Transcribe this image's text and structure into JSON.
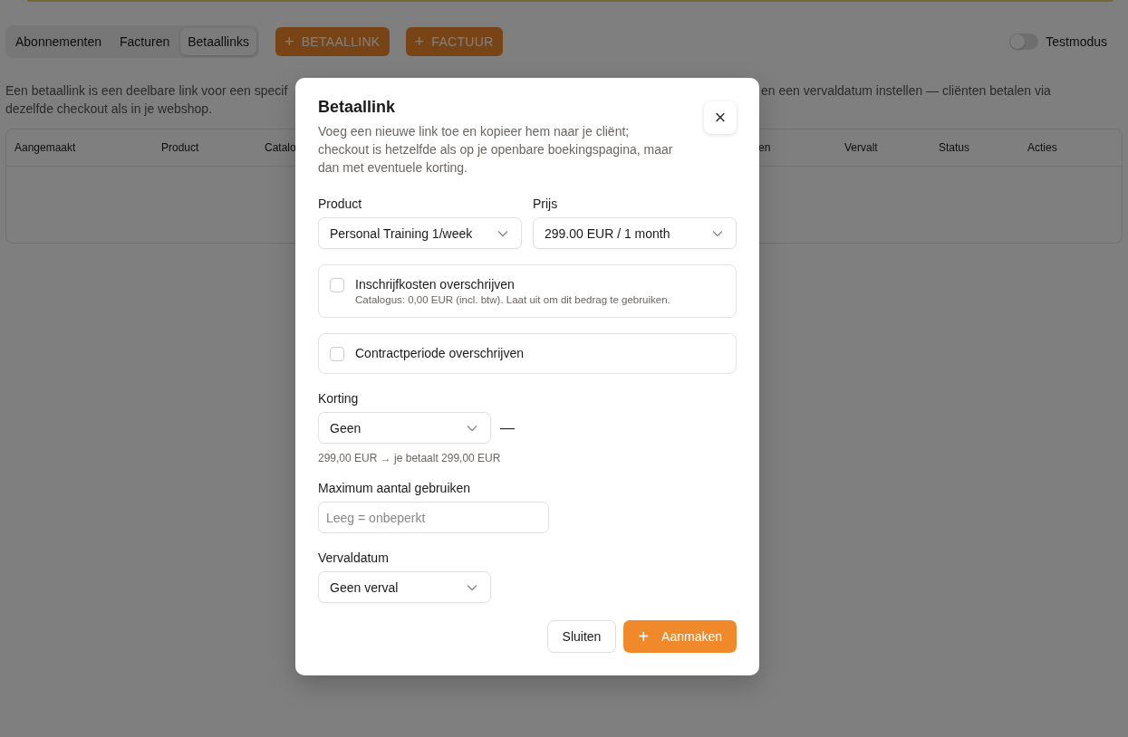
{
  "tabs": [
    {
      "label": "Abonnementen",
      "selected": false
    },
    {
      "label": "Facturen",
      "selected": false
    },
    {
      "label": "Betaallinks",
      "selected": true
    }
  ],
  "actions": [
    {
      "icon": "+",
      "label": "BETAALLINK"
    },
    {
      "icon": "+",
      "label": "FACTUUR"
    }
  ],
  "testmode": {
    "label": "Testmodus",
    "on": false
  },
  "description": {
    "line_1_start": "Een betaallink is een deelbare link voor een specif",
    "line_1_end": "en een vervaldatum instellen — cliënten betalen via",
    "line_2": "dezelfde checkout als in je webshop."
  },
  "table": {
    "columns": [
      "Aangemaakt",
      "Product",
      "Catalo",
      "en",
      "Vervalt",
      "Status",
      "Acties"
    ]
  },
  "dialog": {
    "title": "Betaallink",
    "close": "×",
    "description": "Voeg een nieuwe link toe en kopieer hem naar je cliënt; checkout is hetzelfde als op je openbare boekingspagina, maar dan met eventuele korting.",
    "product": {
      "label": "Product",
      "value": "Personal Training 1/week"
    },
    "price": {
      "label": "Prijs",
      "value": "299.00 EUR / 1 month"
    },
    "overrides": [
      {
        "label": "Inschrijfkosten overschrijven",
        "hint": "Catalogus: 0,00 EUR (incl. btw). Laat uit om dit bedrag te gebruiken.",
        "checked": false
      },
      {
        "label": "Contractperiode overschrijven",
        "checked": false
      }
    ],
    "discount": {
      "label": "Korting",
      "value": "Geen",
      "extra": "—",
      "hint": "299,00 EUR → je betaalt 299,00 EUR"
    },
    "max_uses": {
      "label": "Maximum aantal gebruiken",
      "placeholder": "Leeg = onbeperkt"
    },
    "expiry": {
      "label": "Vervaldatum",
      "value": "Geen verval"
    },
    "buttons": [
      {
        "kind": "secondary",
        "label": "Sluiten"
      },
      {
        "kind": "primary",
        "icon": "+",
        "label": "Aanmaken"
      }
    ]
  }
}
